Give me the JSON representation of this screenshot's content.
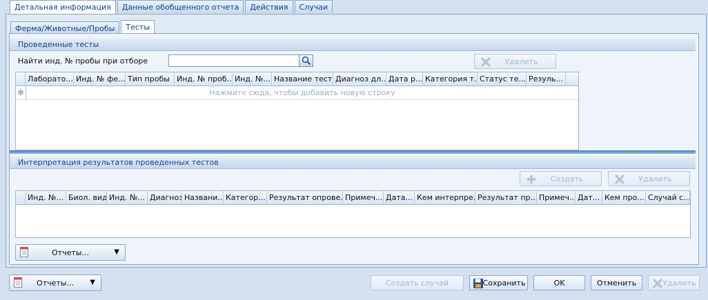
{
  "top_tabs": [
    "Детальная информация",
    "Данные обобщенного отчета",
    "Действия",
    "Случаи"
  ],
  "sub_tabs": [
    "Ферма/Животные/Пробы",
    "Тесты"
  ],
  "tests_section": {
    "title": "Проведенные тесты",
    "search_label": "Найти инд. № пробы при отборе",
    "search_value": "",
    "delete_label": "Удалить",
    "columns": [
      "Лаборато...",
      "Инд. № фе...",
      "Тип пробы",
      "Инд. № проб...",
      "Инд. №...",
      "Название теста",
      "Диагноз дл...",
      "Дата р...",
      "Категория т...",
      "Статус те...",
      "Резуль..."
    ],
    "new_row_hint": "Нажмите сюда, чтобы добавить новую строку"
  },
  "interp_section": {
    "title": "Интерпретация результатов проведенных тестов",
    "create_label": "Создать",
    "delete_label": "Удалить",
    "columns": [
      "Инд. №...",
      "Биол. вид",
      "Инд. №...",
      "Диагноз",
      "Названи...",
      "Категор...",
      "Результат опрове...",
      "Примеч...",
      "Дата...",
      "Кем интерпре...",
      "Результат пр...",
      "Примеч...",
      "Дат...",
      "Кем про...",
      "Случай с..."
    ]
  },
  "reports_inner_label": "Отчеты...",
  "footer": {
    "reports_label": "Отчеты...",
    "create_case_label": "Создать случай",
    "save_label": "Сохранить",
    "ok_label": "OK",
    "cancel_label": "Отменить",
    "delete_label": "Удалить"
  },
  "colors": {
    "accent": "#15428b",
    "frame_border": "#8ea6c6",
    "splitter": "#4e7fc0",
    "disabled_text": "#a7b7cc"
  }
}
